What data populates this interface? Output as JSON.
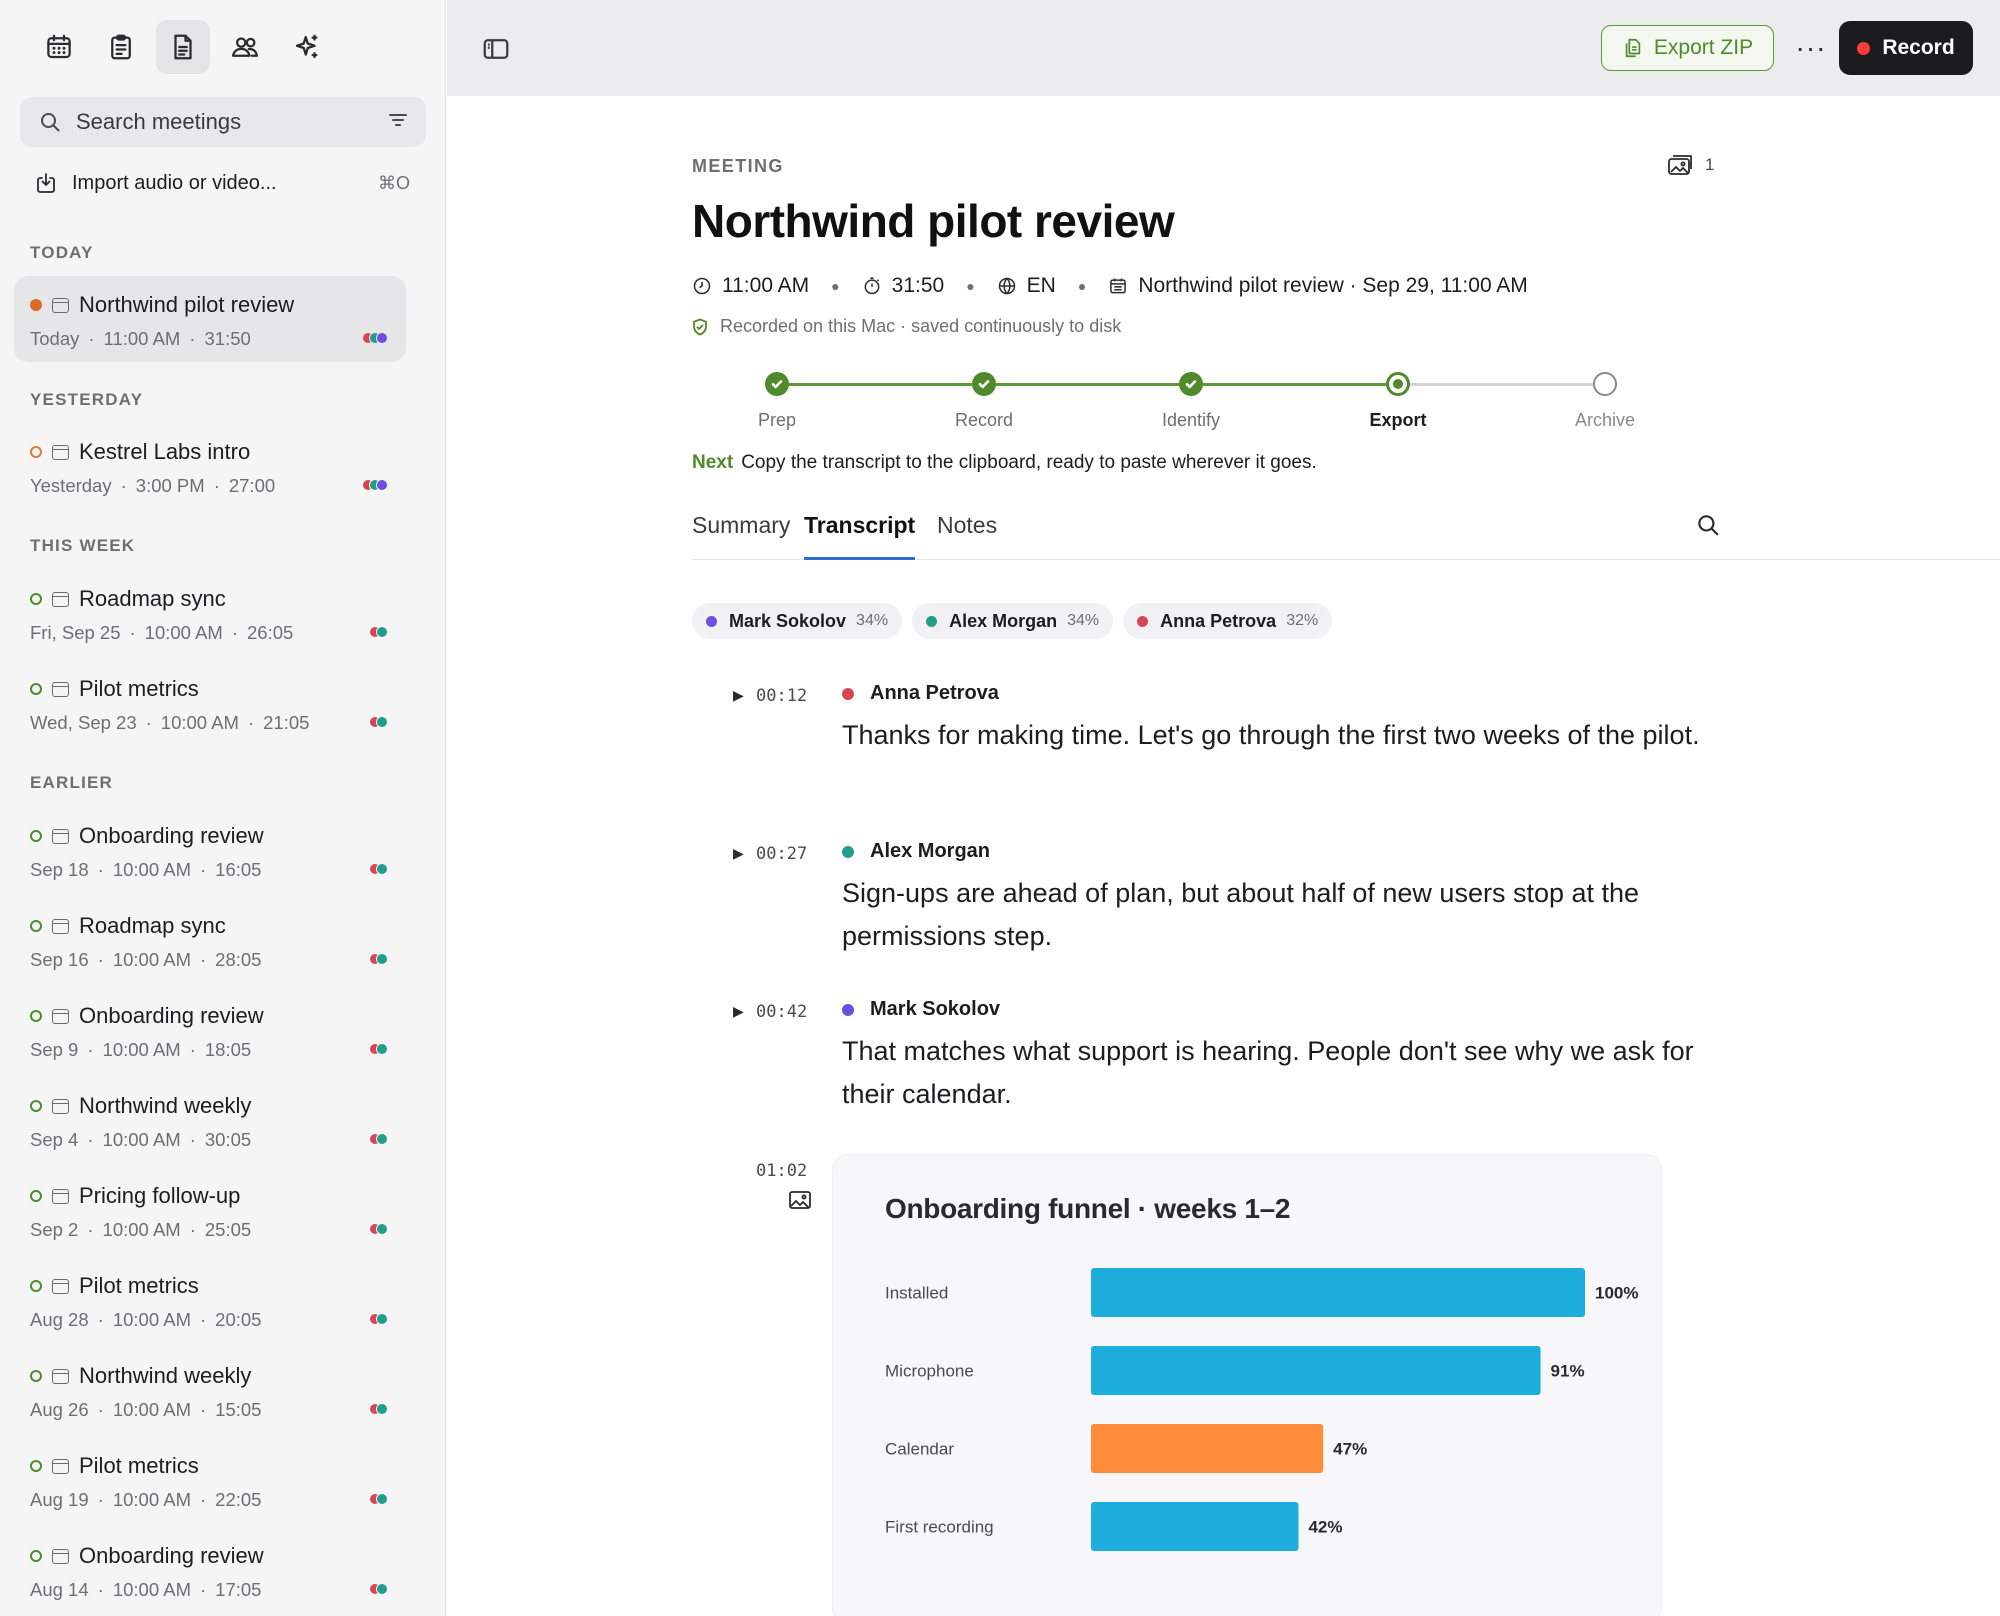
{
  "sidebar": {
    "nav_icons": [
      "calendar-icon",
      "clipboard-icon",
      "document-icon",
      "people-icon",
      "sparkle-icon"
    ],
    "search_placeholder": "Search meetings",
    "import_label": "Import audio or video...",
    "import_shortcut": "⌘O",
    "groups": {
      "today": "TODAY",
      "yesterday": "YESTERDAY",
      "this_week": "THIS WEEK",
      "earlier": "EARLIER"
    },
    "meetings": [
      {
        "title": "Northwind pilot review",
        "day": "Today",
        "time": "11:00 AM",
        "duration": "31:50",
        "status": "recording",
        "avatars": [
          "#d94452",
          "#1f9e8a",
          "#6b4ee0"
        ]
      },
      {
        "title": "Kestrel Labs intro",
        "day": "Yesterday",
        "time": "3:00 PM",
        "duration": "27:00",
        "status": "pending",
        "avatars": [
          "#d94452",
          "#1f9e8a",
          "#6b4ee0"
        ]
      },
      {
        "title": "Roadmap sync",
        "day": "Fri, Sep 25",
        "time": "10:00 AM",
        "duration": "26:05",
        "status": "done",
        "avatars": [
          "#d94452",
          "#1f9e8a"
        ]
      },
      {
        "title": "Pilot metrics",
        "day": "Wed, Sep 23",
        "time": "10:00 AM",
        "duration": "21:05",
        "status": "done",
        "avatars": [
          "#d94452",
          "#1f9e8a"
        ]
      },
      {
        "title": "Onboarding review",
        "day": "Sep 18",
        "time": "10:00 AM",
        "duration": "16:05",
        "status": "done",
        "avatars": [
          "#d94452",
          "#1f9e8a"
        ]
      },
      {
        "title": "Roadmap sync",
        "day": "Sep 16",
        "time": "10:00 AM",
        "duration": "28:05",
        "status": "done",
        "avatars": [
          "#d94452",
          "#1f9e8a"
        ]
      },
      {
        "title": "Onboarding review",
        "day": "Sep 9",
        "time": "10:00 AM",
        "duration": "18:05",
        "status": "done",
        "avatars": [
          "#d94452",
          "#1f9e8a"
        ]
      },
      {
        "title": "Northwind weekly",
        "day": "Sep 4",
        "time": "10:00 AM",
        "duration": "30:05",
        "status": "done",
        "avatars": [
          "#d94452",
          "#1f9e8a"
        ]
      },
      {
        "title": "Pricing follow-up",
        "day": "Sep 2",
        "time": "10:00 AM",
        "duration": "25:05",
        "status": "done",
        "avatars": [
          "#d94452",
          "#1f9e8a"
        ]
      },
      {
        "title": "Pilot metrics",
        "day": "Aug 28",
        "time": "10:00 AM",
        "duration": "20:05",
        "status": "done",
        "avatars": [
          "#d94452",
          "#1f9e8a"
        ]
      },
      {
        "title": "Northwind weekly",
        "day": "Aug 26",
        "time": "10:00 AM",
        "duration": "15:05",
        "status": "done",
        "avatars": [
          "#d94452",
          "#1f9e8a"
        ]
      },
      {
        "title": "Pilot metrics",
        "day": "Aug 19",
        "time": "10:00 AM",
        "duration": "22:05",
        "status": "done",
        "avatars": [
          "#d94452",
          "#1f9e8a"
        ]
      },
      {
        "title": "Onboarding review",
        "day": "Aug 14",
        "time": "10:00 AM",
        "duration": "17:05",
        "status": "done",
        "avatars": [
          "#d94452",
          "#1f9e8a"
        ]
      }
    ]
  },
  "toolbar": {
    "export_label": "Export ZIP",
    "more_label": "···",
    "record_label": "Record"
  },
  "meeting": {
    "kicker": "MEETING",
    "screenshot_count": "1",
    "title": "Northwind pilot review",
    "start_time": "11:00 AM",
    "duration": "31:50",
    "language": "EN",
    "calendar_event": "Northwind pilot review · Sep 29, 11:00 AM",
    "saved_note": "Recorded on this Mac · saved continuously to disk",
    "steps": [
      {
        "label": "Prep",
        "state": "done"
      },
      {
        "label": "Record",
        "state": "done"
      },
      {
        "label": "Identify",
        "state": "done"
      },
      {
        "label": "Export",
        "state": "current"
      },
      {
        "label": "Archive",
        "state": "todo"
      }
    ],
    "next_label": "Next",
    "next_text": "Copy the transcript to the clipboard, ready to paste wherever it goes.",
    "tabs": [
      "Summary",
      "Transcript",
      "Notes"
    ],
    "active_tab": "Transcript",
    "speakers": [
      {
        "name": "Mark Sokolov",
        "pct": "34%",
        "color": "#6b4ee0"
      },
      {
        "name": "Alex Morgan",
        "pct": "34%",
        "color": "#1f9e8a"
      },
      {
        "name": "Anna Petrova",
        "pct": "32%",
        "color": "#d94452"
      }
    ],
    "segments": [
      {
        "ts": "00:12",
        "speaker": "Anna Petrova",
        "color": "#d94452",
        "text": "Thanks for making time. Let's go through the first two weeks of the pilot."
      },
      {
        "ts": "00:27",
        "speaker": "Alex Morgan",
        "color": "#1f9e8a",
        "text": "Sign-ups are ahead of plan, but about half of new users stop at the permissions step."
      },
      {
        "ts": "00:42",
        "speaker": "Mark Sokolov",
        "color": "#6b4ee0",
        "text": "That matches what support is hearing. People don't see why we ask for their calendar."
      }
    ],
    "screenshot_ts": "01:02"
  },
  "chart_data": {
    "type": "bar",
    "orientation": "horizontal",
    "title": "Onboarding funnel · weeks 1–2",
    "categories": [
      "Installed",
      "Microphone",
      "Calendar",
      "First recording"
    ],
    "values": [
      100,
      91,
      47,
      42
    ],
    "value_labels": [
      "100%",
      "91%",
      "47%",
      "42%"
    ],
    "colors": [
      "#1eaede",
      "#1eaede",
      "#ff8c3a",
      "#1eaede"
    ],
    "xlim": [
      0,
      100
    ],
    "grid": false,
    "legend": "none"
  }
}
